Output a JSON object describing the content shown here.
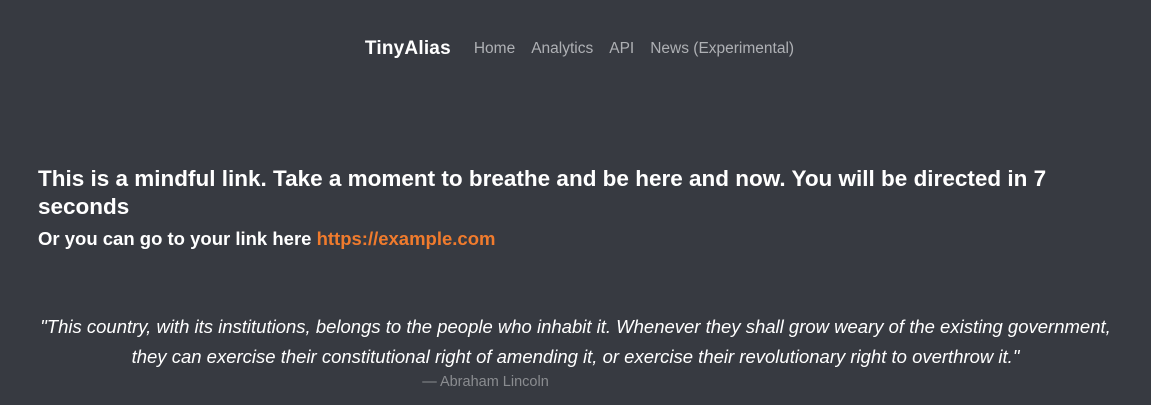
{
  "navbar": {
    "brand": "TinyAlias",
    "links": [
      {
        "label": "Home"
      },
      {
        "label": "Analytics"
      },
      {
        "label": "API"
      },
      {
        "label": "News (Experimental)"
      }
    ]
  },
  "main": {
    "headline": "This is a mindful link. Take a moment to breathe and be here and now. You will be directed in 7 seconds",
    "subline_prefix": "Or you can go to your link here",
    "link_text": "https://example.com"
  },
  "quote": {
    "text": "\"This country, with its institutions, belongs to the people who inhabit it. Whenever they shall grow weary of the existing government, they can exercise their constitutional right of amending it, or exercise their revolutionary right to overthrow it.\"",
    "author": "— Abraham Lincoln"
  },
  "colors": {
    "background": "#373a41",
    "accent_link": "#f07b2d",
    "nav_link": "#aeb0b4",
    "muted": "#8a8c90"
  }
}
